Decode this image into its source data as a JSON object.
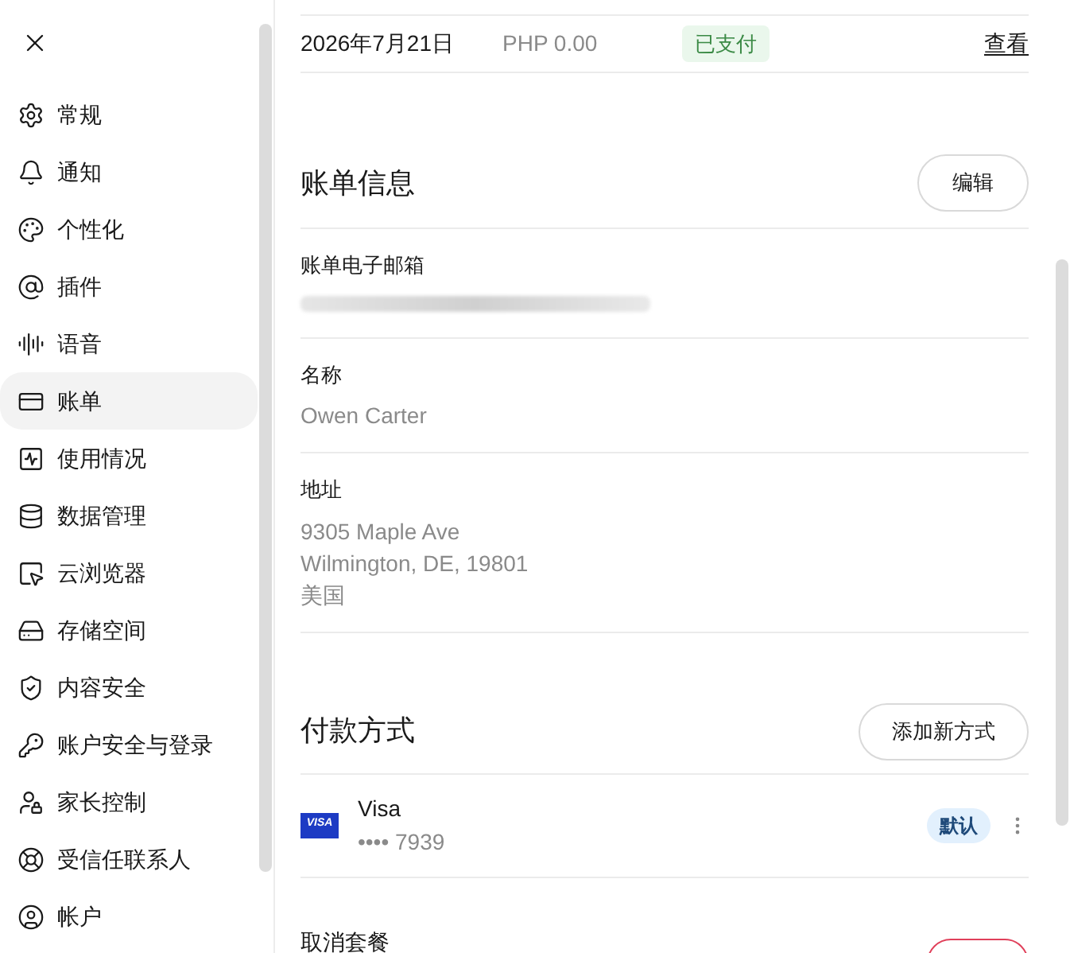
{
  "sidebar": {
    "items": [
      {
        "label": "常规",
        "selected": false
      },
      {
        "label": "通知",
        "selected": false
      },
      {
        "label": "个性化",
        "selected": false
      },
      {
        "label": "插件",
        "selected": false
      },
      {
        "label": "语音",
        "selected": false
      },
      {
        "label": "账单",
        "selected": true
      },
      {
        "label": "使用情况",
        "selected": false
      },
      {
        "label": "数据管理",
        "selected": false
      },
      {
        "label": "云浏览器",
        "selected": false
      },
      {
        "label": "存储空间",
        "selected": false
      },
      {
        "label": "内容安全",
        "selected": false
      },
      {
        "label": "账户安全与登录",
        "selected": false
      },
      {
        "label": "家长控制",
        "selected": false
      },
      {
        "label": "受信任联系人",
        "selected": false
      },
      {
        "label": "帐户",
        "selected": false
      }
    ]
  },
  "invoice": {
    "date": "2026年7月21日",
    "amount": "PHP 0.00",
    "status": "已支付",
    "action": "查看"
  },
  "billing_info": {
    "title": "账单信息",
    "edit_button": "编辑",
    "fields": [
      {
        "label": "账单电子邮箱",
        "kind": "redacted"
      },
      {
        "label": "名称",
        "kind": "text",
        "lines": [
          "Owen Carter"
        ]
      },
      {
        "label": "地址",
        "kind": "text",
        "lines": [
          "9305 Maple Ave",
          "Wilmington, DE, 19801",
          "美国"
        ]
      }
    ]
  },
  "payment_methods": {
    "title": "付款方式",
    "add_button": "添加新方式",
    "cards": [
      {
        "brand": "Visa",
        "logo": "VISA",
        "number": "•••• 7939",
        "default_badge": "默认"
      }
    ]
  },
  "cancel_plan": {
    "label": "取消套餐"
  }
}
